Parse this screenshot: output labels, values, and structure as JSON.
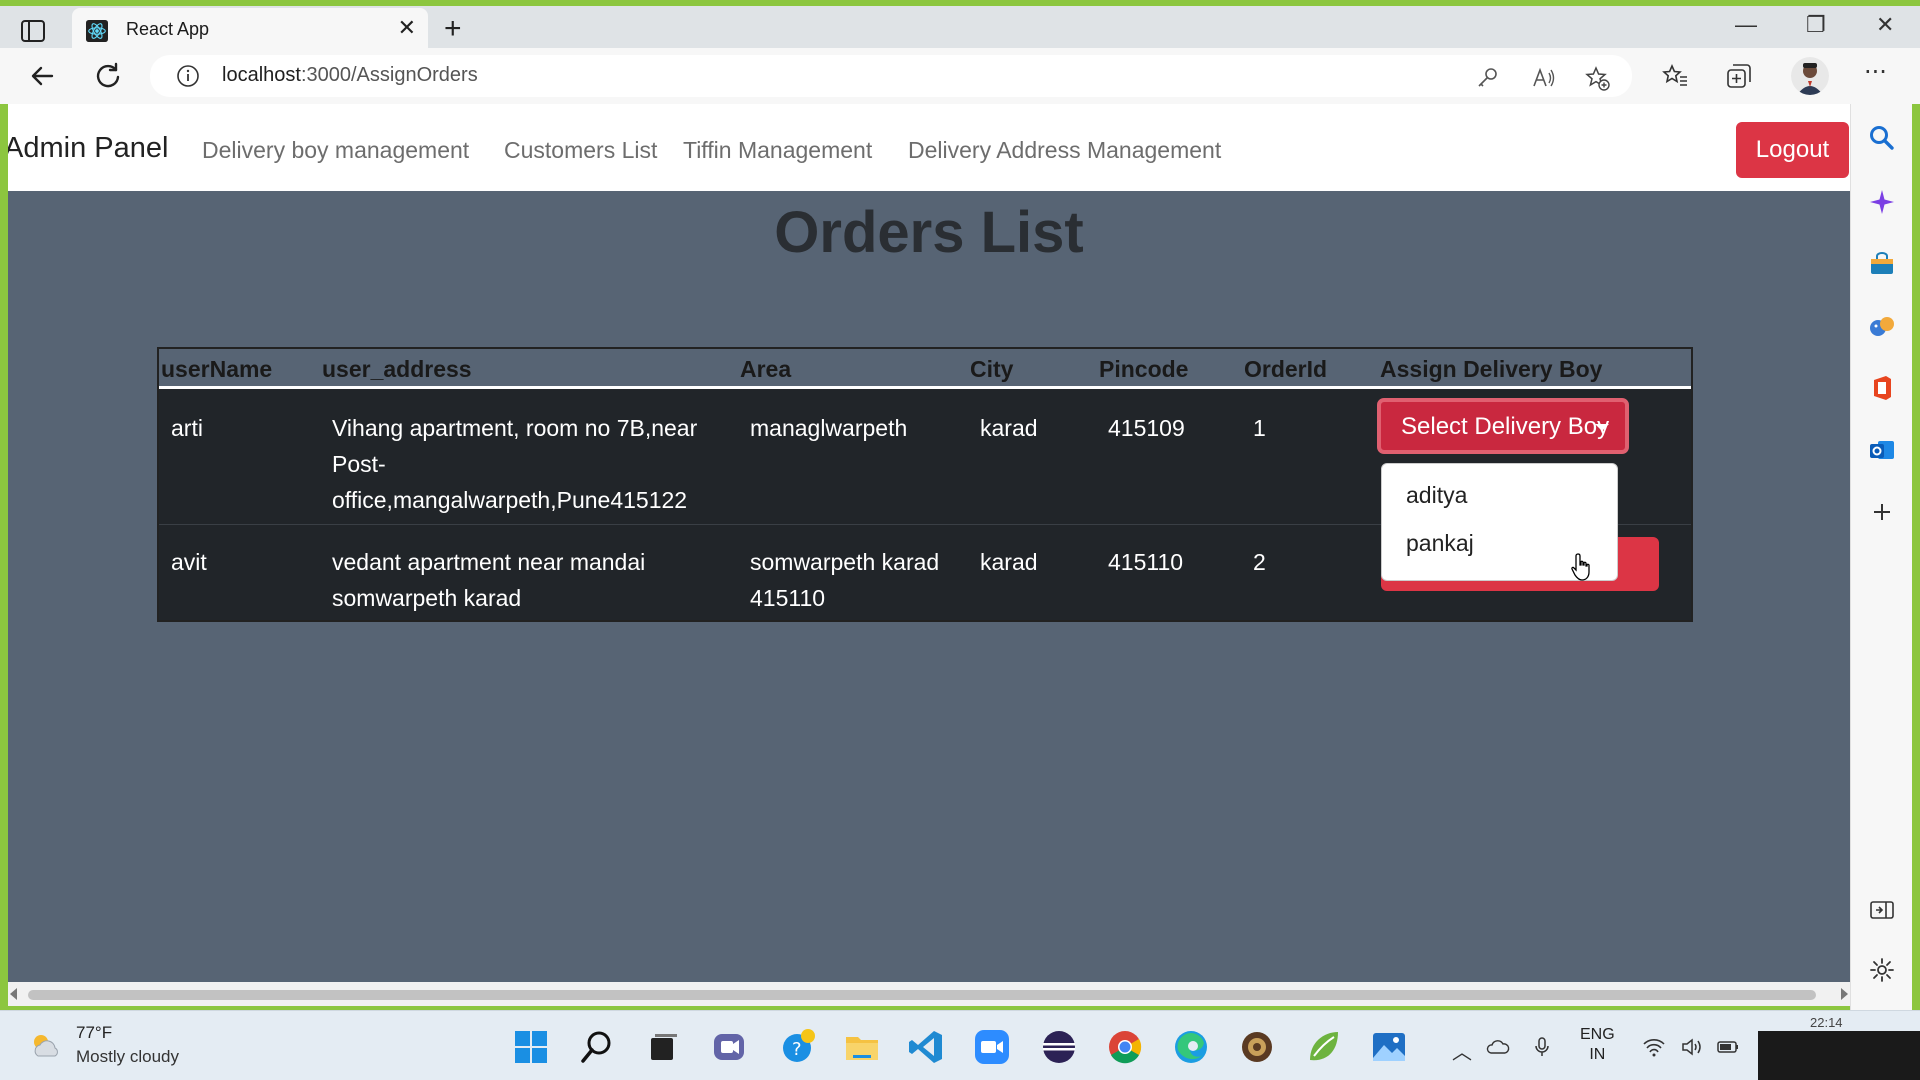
{
  "browser": {
    "tab_title": "React App",
    "url_host": "localhost",
    "url_path": ":3000/AssignOrders"
  },
  "navbar": {
    "brand": "Admin Panel",
    "links": [
      "Delivery boy management",
      "Customers List",
      "Tiffin Management",
      "Delivery Address Management"
    ],
    "logout_label": "Logout"
  },
  "page": {
    "title": "Orders List"
  },
  "table": {
    "headers": [
      "userName",
      "user_address",
      "Area",
      "City",
      "Pincode",
      "OrderId",
      "Assign Delivery Boy"
    ],
    "rows": [
      {
        "userName": "arti",
        "user_address": [
          "Vihang apartment, room no 7B,near",
          "Post-",
          "office,mangalwarpeth,Pune415122"
        ],
        "area": [
          "managlwarpeth"
        ],
        "city": "karad",
        "pincode": "415109",
        "orderId": "1"
      },
      {
        "userName": "avit",
        "user_address": [
          "vedant apartment near mandai",
          "somwarpeth karad"
        ],
        "area": [
          "somwarpeth karad",
          "415110"
        ],
        "city": "karad",
        "pincode": "415110",
        "orderId": "2"
      }
    ]
  },
  "assign": {
    "button_label": "Select Delivery Boy",
    "options": [
      "aditya",
      "pankaj"
    ]
  },
  "taskbar": {
    "weather_temp": "77°F",
    "weather_desc": "Mostly cloudy",
    "lang_line1": "ENG",
    "lang_line2": "IN",
    "clock": "22:14"
  },
  "colors": {
    "page_bg": "#576474",
    "table_bg": "#212529",
    "danger": "#dc3545",
    "accent_green": "#8cc63f"
  }
}
